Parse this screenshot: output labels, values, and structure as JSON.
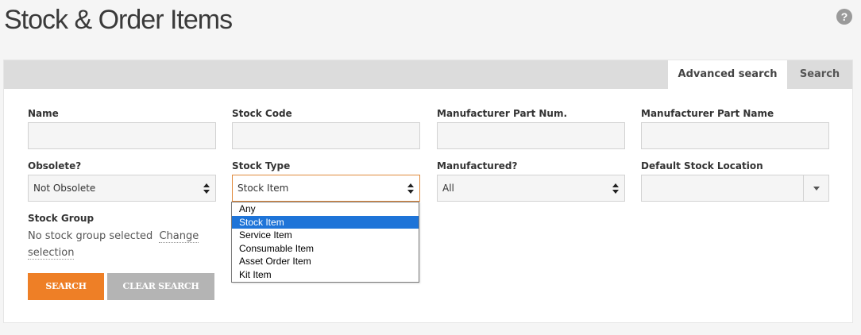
{
  "page": {
    "title": "Stock & Order Items",
    "help_icon": "?"
  },
  "tabs": [
    {
      "label": "Advanced search",
      "active": true
    },
    {
      "label": "Search",
      "active": false
    }
  ],
  "fields": {
    "name": {
      "label": "Name",
      "value": ""
    },
    "stock_code": {
      "label": "Stock Code",
      "value": ""
    },
    "manufacturer_part_num": {
      "label": "Manufacturer Part Num.",
      "value": ""
    },
    "manufacturer_part_name": {
      "label": "Manufacturer Part Name",
      "value": ""
    },
    "obsolete": {
      "label": "Obsolete?",
      "value": "Not Obsolete"
    },
    "stock_type": {
      "label": "Stock Type",
      "value": "Stock Item",
      "options": [
        "Any",
        "Stock Item",
        "Service Item",
        "Consumable Item",
        "Asset Order Item",
        "Kit Item"
      ],
      "selected_index": 1
    },
    "manufactured": {
      "label": "Manufactured?",
      "value": "All"
    },
    "default_stock_location": {
      "label": "Default Stock Location",
      "value": ""
    },
    "stock_group": {
      "label": "Stock Group",
      "text": "No stock group selected",
      "link": "Change selection"
    }
  },
  "buttons": {
    "search": "SEARCH",
    "clear": "CLEAR SEARCH"
  },
  "colors": {
    "search_button": "#ee7f26",
    "clear_button": "#b4b4b4",
    "focus_border": "#e08a3c",
    "option_highlight": "#1e74d8"
  }
}
